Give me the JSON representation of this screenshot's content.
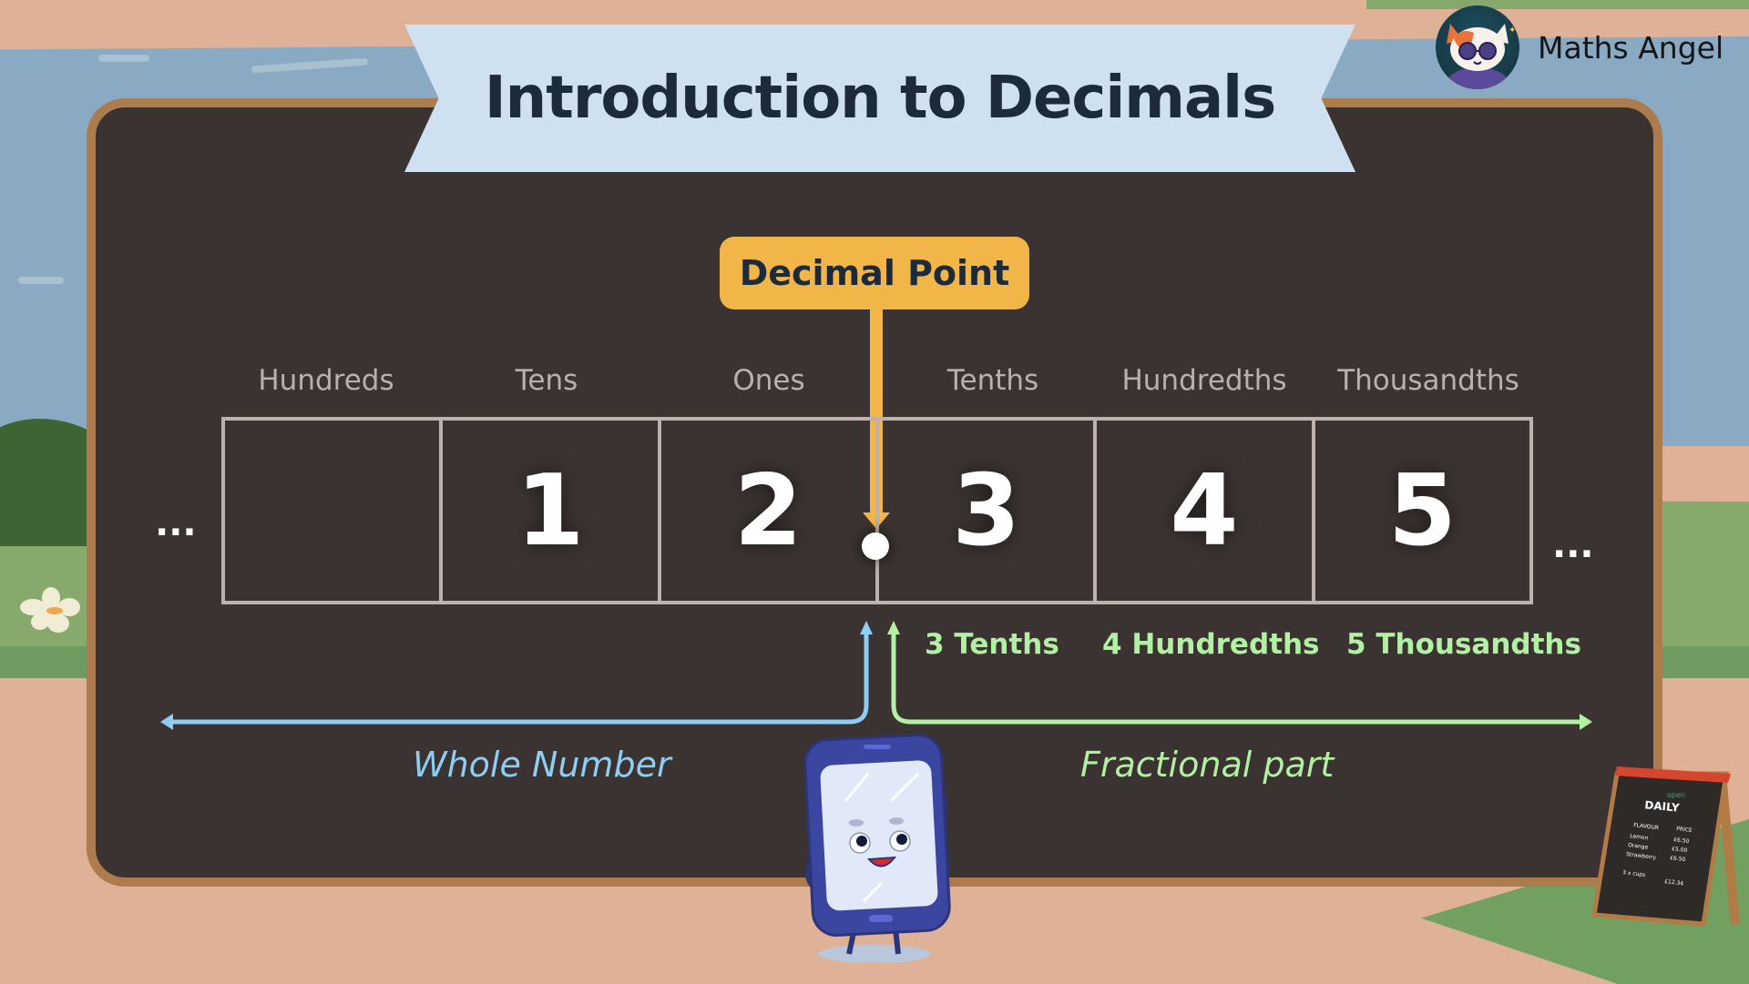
{
  "brand": {
    "name": "Maths Angel",
    "logo_icon": "cat-mascot-with-sunglasses-icon"
  },
  "banner": {
    "title": "Introduction to Decimals"
  },
  "callout": {
    "label": "Decimal Point",
    "color": "#f2b548"
  },
  "place_value_chart": {
    "columns": [
      {
        "label": "Hundreds",
        "digit": ""
      },
      {
        "label": "Tens",
        "digit": "1"
      },
      {
        "label": "Ones",
        "digit": "2"
      },
      {
        "label": "Tenths",
        "digit": "3"
      },
      {
        "label": "Hundredths",
        "digit": "4"
      },
      {
        "label": "Thousandths",
        "digit": "5"
      }
    ],
    "left_ellipsis": "...",
    "right_ellipsis": "...",
    "decimal_separator": ".",
    "number": "12.345"
  },
  "place_notes": [
    {
      "text": "3 Tenths"
    },
    {
      "text": "4 Hundredths"
    },
    {
      "text": "5 Thousandths"
    }
  ],
  "parts": {
    "whole": {
      "label": "Whole Number",
      "color": "#8fcdf2"
    },
    "fractional": {
      "label": "Fractional part",
      "color": "#b2f0a3"
    }
  },
  "illustrations": {
    "mascot": "smiling-phone-character-icon",
    "menu_board": {
      "heading_small": "open",
      "heading": "DAILY",
      "columns": [
        "FLAVOUR",
        "PRICE"
      ],
      "rows": [
        {
          "item": "Lemon",
          "price": "£6.50"
        },
        {
          "item": "Orange",
          "price": "£5.00"
        },
        {
          "item": "Strawberry",
          "price": "£6.50"
        }
      ],
      "total_label": "3 x cups",
      "total_price": "£12.34"
    }
  },
  "colors": {
    "board": "#3b3331",
    "board_frame": "#ad7c4e",
    "banner": "#cfe1f1",
    "title_text": "#1c2a3a",
    "column_label": "#b9b1ad",
    "grid_line": "#bdb2ae"
  }
}
